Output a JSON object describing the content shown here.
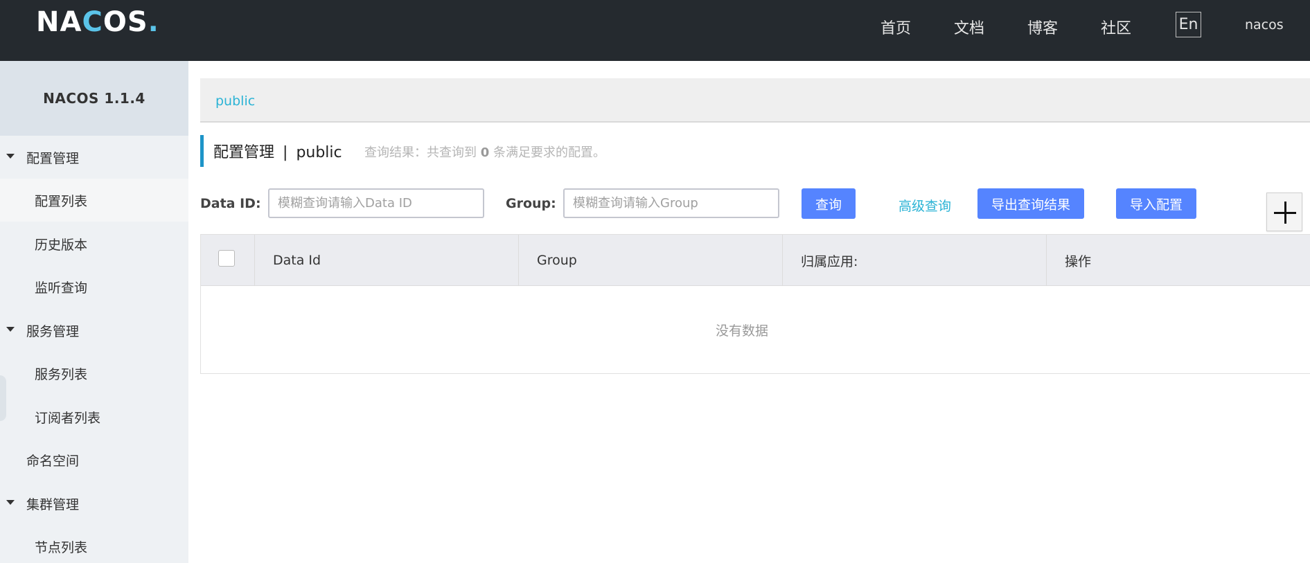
{
  "header": {
    "logo_text": "NACOS.",
    "nav": [
      "首页",
      "文档",
      "博客",
      "社区"
    ],
    "lang": "En",
    "user": "nacos"
  },
  "sidebar": {
    "version": "NACOS 1.1.4",
    "items": [
      {
        "label": "配置管理",
        "type": "group",
        "expanded": true
      },
      {
        "label": "配置列表",
        "type": "sub",
        "active": true
      },
      {
        "label": "历史版本",
        "type": "sub"
      },
      {
        "label": "监听查询",
        "type": "sub"
      },
      {
        "label": "服务管理",
        "type": "group",
        "expanded": true
      },
      {
        "label": "服务列表",
        "type": "sub"
      },
      {
        "label": "订阅者列表",
        "type": "sub"
      },
      {
        "label": "命名空间",
        "type": "group"
      },
      {
        "label": "集群管理",
        "type": "group",
        "expanded": true
      },
      {
        "label": "节点列表",
        "type": "sub"
      }
    ]
  },
  "namespace": {
    "current": "public"
  },
  "page": {
    "title": "配置管理",
    "title_sep": "|",
    "title_ns": "public",
    "result_prefix": "查询结果：共查询到",
    "result_count": "0",
    "result_suffix": "条满足要求的配置。"
  },
  "search": {
    "data_id_label": "Data ID:",
    "data_id_placeholder": "模糊查询请输入Data ID",
    "group_label": "Group:",
    "group_placeholder": "模糊查询请输入Group",
    "query_button": "查询",
    "advanced_link": "高级查询",
    "export_button": "导出查询结果",
    "import_button": "导入配置"
  },
  "table": {
    "columns": [
      "Data Id",
      "Group",
      "归属应用:",
      "操作"
    ],
    "empty_text": "没有数据"
  },
  "colors": {
    "topbar": "#252a2f",
    "accent_link": "#2bb3d5",
    "primary_button": "#5584ff",
    "title_bar": "#1d94c8"
  }
}
